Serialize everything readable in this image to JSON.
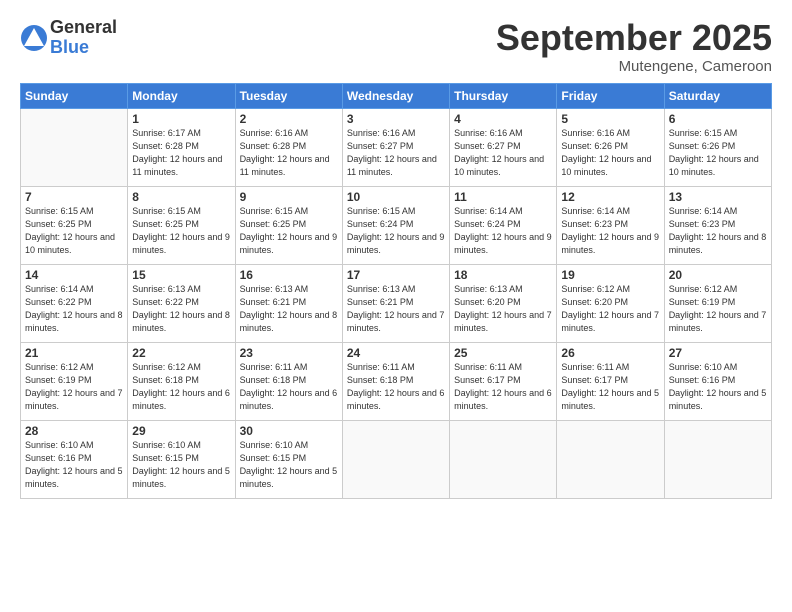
{
  "logo": {
    "general": "General",
    "blue": "Blue"
  },
  "header": {
    "month": "September 2025",
    "location": "Mutengene, Cameroon"
  },
  "weekdays": [
    "Sunday",
    "Monday",
    "Tuesday",
    "Wednesday",
    "Thursday",
    "Friday",
    "Saturday"
  ],
  "weeks": [
    [
      {
        "day": "",
        "info": ""
      },
      {
        "day": "1",
        "info": "Sunrise: 6:17 AM\nSunset: 6:28 PM\nDaylight: 12 hours\nand 11 minutes."
      },
      {
        "day": "2",
        "info": "Sunrise: 6:16 AM\nSunset: 6:28 PM\nDaylight: 12 hours\nand 11 minutes."
      },
      {
        "day": "3",
        "info": "Sunrise: 6:16 AM\nSunset: 6:27 PM\nDaylight: 12 hours\nand 11 minutes."
      },
      {
        "day": "4",
        "info": "Sunrise: 6:16 AM\nSunset: 6:27 PM\nDaylight: 12 hours\nand 10 minutes."
      },
      {
        "day": "5",
        "info": "Sunrise: 6:16 AM\nSunset: 6:26 PM\nDaylight: 12 hours\nand 10 minutes."
      },
      {
        "day": "6",
        "info": "Sunrise: 6:15 AM\nSunset: 6:26 PM\nDaylight: 12 hours\nand 10 minutes."
      }
    ],
    [
      {
        "day": "7",
        "info": "Sunrise: 6:15 AM\nSunset: 6:25 PM\nDaylight: 12 hours\nand 10 minutes."
      },
      {
        "day": "8",
        "info": "Sunrise: 6:15 AM\nSunset: 6:25 PM\nDaylight: 12 hours\nand 9 minutes."
      },
      {
        "day": "9",
        "info": "Sunrise: 6:15 AM\nSunset: 6:25 PM\nDaylight: 12 hours\nand 9 minutes."
      },
      {
        "day": "10",
        "info": "Sunrise: 6:15 AM\nSunset: 6:24 PM\nDaylight: 12 hours\nand 9 minutes."
      },
      {
        "day": "11",
        "info": "Sunrise: 6:14 AM\nSunset: 6:24 PM\nDaylight: 12 hours\nand 9 minutes."
      },
      {
        "day": "12",
        "info": "Sunrise: 6:14 AM\nSunset: 6:23 PM\nDaylight: 12 hours\nand 9 minutes."
      },
      {
        "day": "13",
        "info": "Sunrise: 6:14 AM\nSunset: 6:23 PM\nDaylight: 12 hours\nand 8 minutes."
      }
    ],
    [
      {
        "day": "14",
        "info": "Sunrise: 6:14 AM\nSunset: 6:22 PM\nDaylight: 12 hours\nand 8 minutes."
      },
      {
        "day": "15",
        "info": "Sunrise: 6:13 AM\nSunset: 6:22 PM\nDaylight: 12 hours\nand 8 minutes."
      },
      {
        "day": "16",
        "info": "Sunrise: 6:13 AM\nSunset: 6:21 PM\nDaylight: 12 hours\nand 8 minutes."
      },
      {
        "day": "17",
        "info": "Sunrise: 6:13 AM\nSunset: 6:21 PM\nDaylight: 12 hours\nand 7 minutes."
      },
      {
        "day": "18",
        "info": "Sunrise: 6:13 AM\nSunset: 6:20 PM\nDaylight: 12 hours\nand 7 minutes."
      },
      {
        "day": "19",
        "info": "Sunrise: 6:12 AM\nSunset: 6:20 PM\nDaylight: 12 hours\nand 7 minutes."
      },
      {
        "day": "20",
        "info": "Sunrise: 6:12 AM\nSunset: 6:19 PM\nDaylight: 12 hours\nand 7 minutes."
      }
    ],
    [
      {
        "day": "21",
        "info": "Sunrise: 6:12 AM\nSunset: 6:19 PM\nDaylight: 12 hours\nand 7 minutes."
      },
      {
        "day": "22",
        "info": "Sunrise: 6:12 AM\nSunset: 6:18 PM\nDaylight: 12 hours\nand 6 minutes."
      },
      {
        "day": "23",
        "info": "Sunrise: 6:11 AM\nSunset: 6:18 PM\nDaylight: 12 hours\nand 6 minutes."
      },
      {
        "day": "24",
        "info": "Sunrise: 6:11 AM\nSunset: 6:18 PM\nDaylight: 12 hours\nand 6 minutes."
      },
      {
        "day": "25",
        "info": "Sunrise: 6:11 AM\nSunset: 6:17 PM\nDaylight: 12 hours\nand 6 minutes."
      },
      {
        "day": "26",
        "info": "Sunrise: 6:11 AM\nSunset: 6:17 PM\nDaylight: 12 hours\nand 5 minutes."
      },
      {
        "day": "27",
        "info": "Sunrise: 6:10 AM\nSunset: 6:16 PM\nDaylight: 12 hours\nand 5 minutes."
      }
    ],
    [
      {
        "day": "28",
        "info": "Sunrise: 6:10 AM\nSunset: 6:16 PM\nDaylight: 12 hours\nand 5 minutes."
      },
      {
        "day": "29",
        "info": "Sunrise: 6:10 AM\nSunset: 6:15 PM\nDaylight: 12 hours\nand 5 minutes."
      },
      {
        "day": "30",
        "info": "Sunrise: 6:10 AM\nSunset: 6:15 PM\nDaylight: 12 hours\nand 5 minutes."
      },
      {
        "day": "",
        "info": ""
      },
      {
        "day": "",
        "info": ""
      },
      {
        "day": "",
        "info": ""
      },
      {
        "day": "",
        "info": ""
      }
    ]
  ]
}
